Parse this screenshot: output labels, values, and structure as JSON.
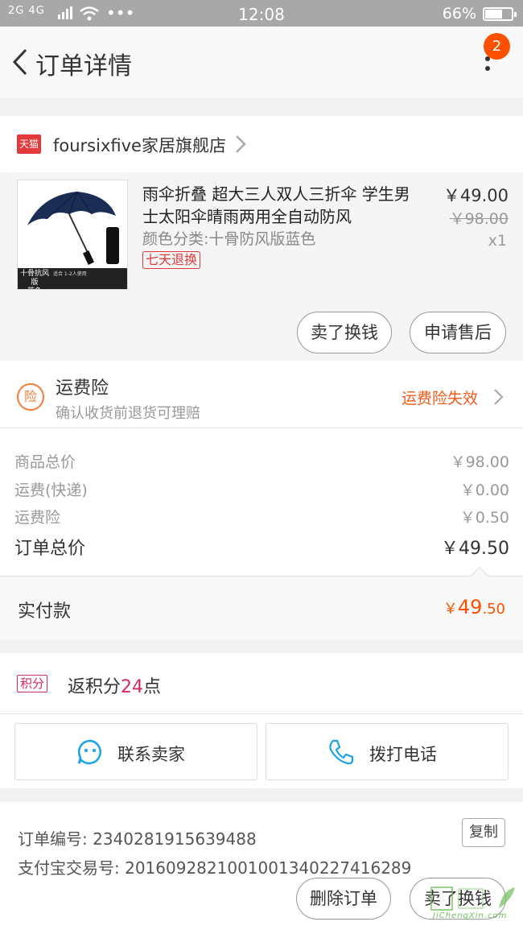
{
  "status_bar": {
    "signal_text": "2G 4G",
    "time": "12:08",
    "battery": "66%",
    "battery_level": 0.66
  },
  "header": {
    "title": "订单详情",
    "notification_count": "2"
  },
  "store": {
    "badge": "天猫",
    "name": "foursixfive家居旗舰店"
  },
  "product": {
    "title": "雨伞折叠 超大三人双人三折伞 学生男士太阳伞晴雨两用全自动防风",
    "variant": "颜色分类:十骨防风版蓝色",
    "return_tag": "七天退换",
    "price": "￥49.00",
    "original_price": "￥98.00",
    "quantity": "x1",
    "thumbnail_caption": "十骨抗风版",
    "thumbnail_caption_sub": "蓝色",
    "thumbnail_detail": "适合 1-2人使用",
    "sell_button": "卖了换钱",
    "after_sale_button": "申请售后"
  },
  "insurance": {
    "icon_text": "险",
    "title": "运费险",
    "subtitle": "确认收货前退货可理赔",
    "status": "运费险失效"
  },
  "breakdown": {
    "rows": [
      {
        "label": "商品总价",
        "value": "￥98.00"
      },
      {
        "label": "运费(快递)",
        "value": "￥0.00"
      },
      {
        "label": "运费险",
        "value": "￥0.50"
      }
    ],
    "total_label": "订单总价",
    "total_value": "￥49.50",
    "paid_label": "实付款",
    "paid_currency": "￥",
    "paid_integer": "49",
    "paid_decimal": ".50"
  },
  "points": {
    "tag": "积分",
    "prefix": "返积分",
    "amount": "24",
    "suffix": "点"
  },
  "contact": {
    "seller_label": "联系卖家",
    "phone_label": "拨打电话"
  },
  "order_info": {
    "order_no_label": "订单编号: 2340281915639488",
    "alipay_no_label": "支付宝交易号: 2016092821001001340227416289",
    "copy_button": "复制",
    "delete_button": "删除订单",
    "sell_button": "卖了换钱"
  },
  "watermark": {
    "text": "JiChengXin.com"
  },
  "colors": {
    "accent": "#ff5000",
    "tmall_red": "#e4393c",
    "points_pink": "#d12a62",
    "insurance_orange": "#f57b3b",
    "icon_blue": "#1aa3e8"
  }
}
